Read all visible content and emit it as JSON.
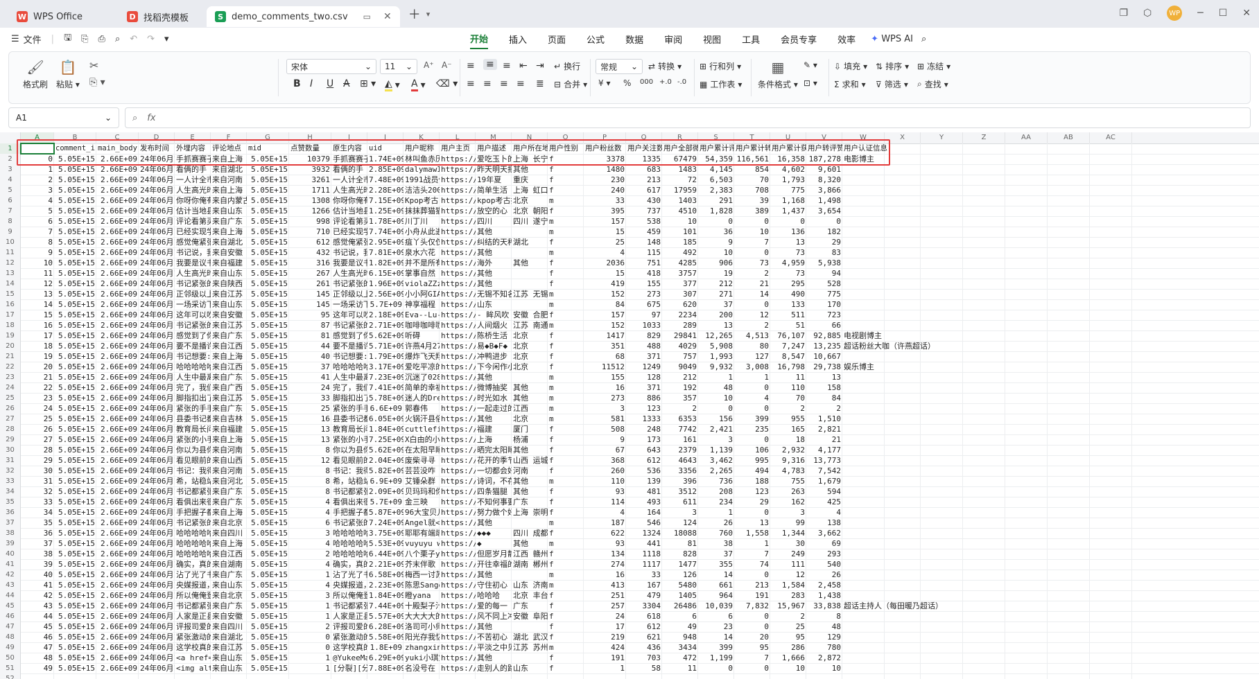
{
  "tabs": [
    {
      "label": "WPS Office",
      "icon": "wps-logo-icon",
      "color": "#e94b3c"
    },
    {
      "label": "找稻壳模板",
      "icon": "docer-icon",
      "color": "#e94b3c"
    },
    {
      "label": "demo_comments_two.csv",
      "icon": "sheet-icon",
      "color": "#1a9e55"
    }
  ],
  "menu": {
    "file": "文件",
    "tabs": [
      "开始",
      "插入",
      "页面",
      "公式",
      "数据",
      "审阅",
      "视图",
      "工具",
      "会员专享",
      "效率"
    ],
    "active": "开始",
    "ai": "WPS AI"
  },
  "ribbon": {
    "format_painter": "格式刷",
    "paste": "粘贴",
    "font": "宋体",
    "size": "11",
    "wrap": "换行",
    "merge": "合并",
    "number_format": "常规",
    "convert": "转换",
    "rowcol": "行和列",
    "worksheet": "工作表",
    "cond_format": "条件格式",
    "fill": "填充",
    "sort": "排序",
    "freeze": "冻结",
    "sum": "求和",
    "filter": "筛选",
    "find": "查找"
  },
  "formula_bar": {
    "cell_ref": "A1",
    "formula": ""
  },
  "columns": [
    "A",
    "B",
    "C",
    "D",
    "E",
    "F",
    "G",
    "H",
    "I",
    "J",
    "K",
    "L",
    "M",
    "N",
    "O",
    "P",
    "Q",
    "R",
    "S",
    "T",
    "U",
    "V",
    "W",
    "X",
    "Y",
    "Z",
    "AA",
    "AB",
    "AC"
  ],
  "header_row": [
    "",
    "comment_i",
    "main_body",
    "发布时间",
    "外埋内容",
    "评论地点",
    "mid",
    "点赞数量",
    "原生内容",
    "uid",
    "用户昵称",
    "用户主页",
    "用户描述",
    "用户所在地",
    "用户性别",
    "用户粉丝数",
    "用户关注数",
    "用户全部微",
    "用户累计评",
    "用户累计转",
    "用户累计获",
    "用户转评赞",
    "用户认证信息"
  ],
  "rows": [
    [
      "0",
      "5.05E+15",
      "2.66E+09",
      "24年06月1",
      "手抓赛赛子",
      "来自上海",
      "5.05E+15",
      "10379",
      "手抓赛赛子",
      "1.74E+09",
      "林叫鱼赤历",
      "https://we",
      "爱吃玉卜的",
      "上海 长宁",
      "f",
      "3378",
      "1335",
      "67479",
      "54,359",
      "116,561",
      "16,358",
      "187,278",
      "电影博主"
    ],
    [
      "1",
      "5.05E+15",
      "2.66E+09",
      "24年06月1",
      "看俩的手",
      "来自湖北",
      "5.05E+15",
      "3932",
      "看俩的手 ",
      "2.85E+09",
      "dalymawI",
      "https://we",
      "昨天明天把",
      "其他",
      "f",
      "1480",
      "683",
      "1483",
      "4,145",
      "854",
      "4,602",
      "9,601",
      ""
    ],
    [
      "2",
      "5.05E+15",
      "2.66E+09",
      "24年06月1",
      "一人计全市",
      "来自河南",
      "5.05E+15",
      "3261",
      "一人计全市",
      "7.48E+09",
      "1991战员你",
      "https://we",
      "19年夏 ",
      "重庆",
      "f",
      "230",
      "213",
      "72",
      "6,503",
      "70",
      "1,793",
      "8,320",
      ""
    ],
    [
      "3",
      "5.05E+15",
      "2.66E+09",
      "24年06月1",
      "人生高光时",
      "来自上海",
      "5.05E+15",
      "1711",
      "人生高光时",
      "2.28E+09",
      "洁洁头2005",
      "https://we",
      "简单生活 ",
      "上海 虹口",
      "f",
      "240",
      "617",
      "17959",
      "2,383",
      "708",
      "775",
      "3,866",
      ""
    ],
    [
      "4",
      "5.05E+15",
      "2.66E+09",
      "24年06月1",
      "你呀你俺有",
      "来自内蒙古",
      "5.05E+15",
      "1308",
      "你呀你俺有",
      "7.15E+09",
      "Kpop考古",
      "https://we",
      "kpop考古抄",
      "北京",
      "m",
      "33",
      "430",
      "1403",
      "291",
      "39",
      "1,168",
      "1,498",
      ""
    ],
    [
      "5",
      "5.05E+15",
      "2.66E+09",
      "24年06月1",
      "估计当地县",
      "来自山东",
      "5.05E+15",
      "1266",
      "估计当地县",
      "1.25E+09",
      "抹抹葬猫猫",
      "https://we",
      "放空的心",
      "北京 朝阳",
      "f",
      "395",
      "737",
      "4510",
      "1,828",
      "389",
      "1,437",
      "3,654",
      ""
    ],
    [
      "6",
      "5.05E+15",
      "2.66E+09",
      "24年06月1",
      "评论看第买",
      "来自广东",
      "5.05E+15",
      "998",
      "评论看第买",
      "1.78E+09",
      "川丁川",
      "https://we",
      "四川 ",
      "四川 遂宁",
      "m",
      "157",
      "538",
      "10",
      "0",
      "0",
      "0",
      "0",
      ""
    ],
    [
      "7",
      "5.05E+15",
      "2.66E+09",
      "24年06月1",
      "已经实现学",
      "来自上海",
      "5.05E+15",
      "710",
      "已经实现学",
      "7.74E+09",
      "小舟从此逝",
      "https://we",
      "其他",
      "",
      "m",
      "15",
      "459",
      "101",
      "36",
      "10",
      "136",
      "182",
      ""
    ],
    [
      "8",
      "5.05E+15",
      "2.66E+09",
      "24年06月1",
      "感觉俺紧张",
      "来自湖北",
      "5.05E+15",
      "612",
      "感觉俺紧张",
      "2.95E+09",
      "疽丫头仅仅",
      "https://we",
      "纠结的天秤",
      "湖北",
      "f",
      "25",
      "148",
      "185",
      "9",
      "7",
      "13",
      "29",
      ""
    ],
    [
      "9",
      "5.05E+15",
      "2.66E+09",
      "24年06月1",
      "书记说，我",
      "来自安徽",
      "5.05E+15",
      "432",
      "书记说，我",
      "7.81E+09",
      "泉水六花",
      "https://we",
      "其他",
      "",
      "m",
      "4",
      "115",
      "492",
      "10",
      "0",
      "73",
      "83",
      ""
    ],
    [
      "10",
      "5.05E+15",
      "2.66E+09",
      "24年06月1",
      "我要是议书",
      "来自福建",
      "5.05E+15",
      "316",
      "我要是议书",
      "1.82E+09",
      "并不是所有",
      "https://we",
      "海外 ",
      "其他",
      "f",
      "2036",
      "751",
      "4285",
      "906",
      "73",
      "4,959",
      "5,938",
      ""
    ],
    [
      "11",
      "5.05E+15",
      "2.66E+09",
      "24年06月1",
      "人生高光时",
      "来自山东",
      "5.05E+15",
      "267",
      "人生高光时",
      "6.15E+09",
      "掌事自然",
      "https://we",
      "其他",
      "",
      "f",
      "15",
      "418",
      "3757",
      "19",
      "2",
      "73",
      "94",
      ""
    ],
    [
      "12",
      "5.05E+15",
      "2.66E+09",
      "24年06月1",
      "书记紧张的",
      "来自陕西",
      "5.05E+15",
      "261",
      "书记紧张的",
      "1.96E+09",
      "violaZZzzz",
      "https://we",
      "其他",
      "",
      "f",
      "419",
      "155",
      "377",
      "212",
      "21",
      "295",
      "528",
      ""
    ],
    [
      "13",
      "5.05E+15",
      "2.66E+09",
      "24年06月1",
      "正邻级以上",
      "来自江苏",
      "5.05E+15",
      "145",
      "正邻级以上",
      "2.56E+09",
      "小小阿GIAC",
      "https://we",
      "无锡不知名",
      "江苏 无锡",
      "m",
      "152",
      "273",
      "307",
      "271",
      "14",
      "490",
      "775",
      ""
    ],
    [
      "14",
      "5.05E+15",
      "2.66E+09",
      "24年06月1",
      "一场采访下",
      "来自山东",
      "5.05E+15",
      "145",
      "一场采访下",
      "5.7E+09",
      "神享福程",
      "https://we",
      "山东",
      "",
      "m",
      "84",
      "675",
      "620",
      "37",
      "0",
      "133",
      "170",
      ""
    ],
    [
      "15",
      "5.05E+15",
      "2.66E+09",
      "24年06月1",
      "这年可以吹",
      "来自安徽",
      "5.05E+15",
      "95",
      "这年可以吹",
      "2.18E+09",
      "Eva--Lu-",
      "https://we",
      "- 眸风吹",
      "安徽 合肥",
      "f",
      "157",
      "97",
      "2234",
      "200",
      "12",
      "511",
      "723",
      ""
    ],
    [
      "16",
      "5.05E+15",
      "2.66E+09",
      "24年06月1",
      "书记紧张的",
      "来自江苏",
      "5.05E+15",
      "87",
      "书记紧张的",
      "2.71E+09",
      "咖啡咖啡咖",
      "https://we",
      "人间烟火",
      "江苏 南通",
      "m",
      "152",
      "1033",
      "289",
      "13",
      "2",
      "51",
      "66",
      ""
    ],
    [
      "17",
      "5.05E+15",
      "2.66E+09",
      "24年06月1",
      "感觉到了你",
      "来自广东",
      "5.05E+15",
      "81",
      "感觉到了你",
      "5.62E+09",
      "听碍",
      "https://we",
      "陈桥生活",
      "北京",
      "f",
      "1417",
      "829",
      "29841",
      "12,265",
      "4,513",
      "76,107",
      "92,885",
      "电视剧博主"
    ],
    [
      "18",
      "5.05E+15",
      "2.66E+09",
      "24年06月1",
      "要不是播许",
      "来自江西",
      "5.05E+15",
      "44",
      "要不是播许",
      "5.71E+09",
      "许燕4月27",
      "https://we",
      "易◆B◆F◆",
      "北京",
      "f",
      "351",
      "488",
      "4029",
      "5,908",
      "80",
      "7,247",
      "13,235",
      "超话粉丝大咖（许燕超话）"
    ],
    [
      "19",
      "5.05E+15",
      "2.66E+09",
      "24年06月1",
      "书记想要:",
      "来自上海",
      "5.05E+15",
      "40",
      "书记想要:",
      "1.79E+09",
      "爆炸飞天翔",
      "https://we",
      "冲鸭进步",
      "北京",
      "f",
      "68",
      "371",
      "757",
      "1,993",
      "127",
      "8,547",
      "10,667",
      ""
    ],
    [
      "20",
      "5.05E+15",
      "2.66E+09",
      "24年06月1",
      "哈哈哈哈哈",
      "来自江西",
      "5.05E+15",
      "37",
      "哈哈哈哈哈",
      "3.17E+09",
      "爱吃平凉的",
      "https://we",
      "下今闲作小",
      "北京",
      "f",
      "11512",
      "1249",
      "9049",
      "9,932",
      "3,008",
      "16,798",
      "29,738",
      "娱乐博主"
    ],
    [
      "21",
      "5.05E+15",
      "2.66E+09",
      "24年06月1",
      "人生中最离",
      "来自广东",
      "5.05E+15",
      "41",
      "人生中最离",
      "7.23E+09",
      "沉迷了0282",
      "https://we",
      "其他",
      "",
      "m",
      "155",
      "128",
      "212",
      "1",
      "1",
      "11",
      "13",
      ""
    ],
    [
      "22",
      "5.05E+15",
      "2.66E+09",
      "24年06月1",
      "完了，我们",
      "来自广西",
      "5.05E+15",
      "24",
      "完了，我们",
      "7.41E+09",
      "简单的幸福",
      "https://we",
      "微博抽奖",
      "其他",
      "m",
      "16",
      "371",
      "192",
      "48",
      "0",
      "110",
      "158",
      ""
    ],
    [
      "23",
      "5.05E+15",
      "2.66E+09",
      "24年06月1",
      "脚指扣出了",
      "来自江苏",
      "5.05E+15",
      "33",
      "脚指扣出了",
      "5.78E+09",
      "迷人的Dres",
      "https://we",
      "时光如水",
      "其他",
      "m",
      "273",
      "886",
      "357",
      "10",
      "4",
      "70",
      "84",
      ""
    ],
    [
      "24",
      "5.05E+15",
      "2.66E+09",
      "24年06月1",
      "紧张的手手",
      "来自广东",
      "5.05E+15",
      "25",
      "紧张的手手",
      "6.6E+09",
      "郭春伟",
      "https://we",
      "一起走过的",
      "江西",
      "m",
      "3",
      "123",
      "2",
      "0",
      "0",
      "2",
      "2",
      ""
    ],
    [
      "25",
      "5.05E+15",
      "2.66E+09",
      "24年06月1",
      "县委书记都",
      "来自吉林",
      "5.05E+15",
      "16",
      "县委书记都",
      "6.05E+09",
      "火锅汗县俗",
      "https://we",
      "其他",
      "北京",
      "m",
      "581",
      "1333",
      "6353",
      "156",
      "399",
      "955",
      "1,510",
      ""
    ],
    [
      "26",
      "5.05E+15",
      "2.66E+09",
      "24年06月1",
      "教育局长问",
      "来自福建",
      "5.05E+15",
      "13",
      "教育局长问",
      "1.84E+09",
      "cuttlefish",
      "https://we",
      "福建 ",
      "厦门",
      "f",
      "508",
      "248",
      "7742",
      "2,421",
      "235",
      "165",
      "2,821",
      ""
    ],
    [
      "27",
      "5.05E+15",
      "2.66E+09",
      "24年06月1",
      "紧张的小手",
      "来自上海",
      "5.05E+15",
      "13",
      "紧张的小手",
      "7.25E+09",
      "X白由的小",
      "https://we",
      "上海 ",
      "杨浦",
      "f",
      "9",
      "173",
      "161",
      "3",
      "0",
      "18",
      "21",
      ""
    ],
    [
      "28",
      "5.05E+15",
      "2.66E+09",
      "24年06月1",
      "你以为县你",
      "来自河南",
      "5.05E+15",
      "8",
      "你以为县你",
      "5.62E+09",
      "在太阳早睡",
      "https://we",
      "晒完太阳睡",
      "其他",
      "f",
      "67",
      "643",
      "2379",
      "1,139",
      "106",
      "2,932",
      "4,177",
      ""
    ],
    [
      "29",
      "5.05E+15",
      "2.66E+09",
      "24年06月1",
      "看见眼前的",
      "来自山西",
      "5.05E+15",
      "12",
      "看见眼前的",
      "2.04E+09",
      "废柴寻寻",
      "https://we",
      "花开的季节",
      "山西 运城",
      "f",
      "368",
      "612",
      "4643",
      "3,462",
      "995",
      "9,316",
      "13,773",
      ""
    ],
    [
      "30",
      "5.05E+15",
      "2.66E+09",
      "24年06月1",
      "书记：我得",
      "来自河南",
      "5.05E+15",
      "8",
      "书记：我得",
      "5.82E+09",
      "芸芸没咋",
      "https://we",
      "一切都会好",
      "河南",
      "f",
      "260",
      "536",
      "3356",
      "2,265",
      "494",
      "4,783",
      "7,542",
      ""
    ],
    [
      "31",
      "5.05E+15",
      "2.66E+09",
      "24年06月1",
      "希，站稳站",
      "来自河北",
      "5.05E+15",
      "8",
      "希，站稳站",
      "6.9E+09",
      "艾锤朵群",
      "https://we",
      "诗词，不存",
      "其他",
      "m",
      "110",
      "139",
      "396",
      "736",
      "188",
      "755",
      "1,679",
      ""
    ],
    [
      "32",
      "5.05E+15",
      "2.66E+09",
      "24年06月1",
      "书记都紧张",
      "来自广东",
      "5.05E+15",
      "8",
      "书记都紧张",
      "2.09E+09",
      "贝玛玛和你",
      "https://we",
      "四条猫腿",
      "其他 ",
      "f",
      "93",
      "481",
      "3512",
      "208",
      "123",
      "263",
      "594",
      ""
    ],
    [
      "33",
      "5.05E+15",
      "2.66E+09",
      "24年06月1",
      "看俱出来很",
      "来自广东",
      "5.05E+15",
      "4",
      "看俱出来很",
      "5.7E+09",
      "金三映",
      "https://we",
      "不知何事要",
      "广东",
      "f",
      "114",
      "493",
      "611",
      "234",
      "29",
      "162",
      "425",
      ""
    ],
    [
      "34",
      "5.05E+15",
      "2.66E+09",
      "24年06月1",
      "手把握子都",
      "来自上海",
      "5.05E+15",
      "4",
      "手把握子都",
      "5.87E+09",
      "96大宝贝儿",
      "https://we",
      "努力做个好",
      "上海 崇明",
      "f",
      "4",
      "164",
      "3",
      "1",
      "0",
      "3",
      "4",
      ""
    ],
    [
      "35",
      "5.05E+15",
      "2.66E+09",
      "24年06月1",
      "书记紧张的",
      "来自北京",
      "5.05E+15",
      "6",
      "书记紧张的",
      "7.24E+09",
      "Angel就</thinking>",
      "https://we",
      "其他",
      "",
      "m",
      "187",
      "546",
      "124",
      "26",
      "13",
      "99",
      "138",
      ""
    ],
    [
      "36",
      "5.05E+15",
      "2.66E+09",
      "24年06月1",
      "哈哈哈哈哈",
      "来自四川",
      "5.05E+15",
      "3",
      "哈哈哈哈哈",
      "3.75E+09",
      "耶耶有端端",
      "https://we",
      "◆◆◆",
      "四川 成都",
      "f",
      "622",
      "1324",
      "18088",
      "760",
      "1,558",
      "1,344",
      "3,662",
      ""
    ],
    [
      "37",
      "5.05E+15",
      "2.66E+09",
      "24年06月1",
      "哈哈哈哈哈",
      "来自上海",
      "5.05E+15",
      "4",
      "哈哈哈哈哈",
      "5.53E+09",
      "vuyuyu wos",
      "https://we",
      "◆",
      "其他",
      "m",
      "93",
      "441",
      "81",
      "38",
      "1",
      "30",
      "69",
      ""
    ],
    [
      "38",
      "5.05E+15",
      "2.66E+09",
      "24年06月1",
      "哈哈哈哈哈",
      "来自江西",
      "5.05E+15",
      "2",
      "哈哈哈哈哈",
      "6.44E+09",
      "八个栗子y",
      "https://we",
      "但愿岁月静",
      "江西 赣州",
      "f",
      "134",
      "1118",
      "828",
      "37",
      "7",
      "249",
      "293",
      ""
    ],
    [
      "39",
      "5.05E+15",
      "2.66E+09",
      "24年06月1",
      "确实，真的",
      "来自湖南",
      "5.05E+15",
      "4",
      "确实，真的",
      "2.21E+09",
      "芥末伴歌",
      "https://we",
      "开往幸福的",
      "湖南 郴州",
      "f",
      "274",
      "1117",
      "1477",
      "355",
      "74",
      "111",
      "540",
      ""
    ],
    [
      "40",
      "5.05E+15",
      "2.66E+09",
      "24年06月1",
      "沾了光了书",
      "来自广东",
      "5.05E+15",
      "1",
      "沾了光了书",
      "6.58E+09",
      "梅西一讨苏",
      "https://we",
      "其他",
      "",
      "m",
      "16",
      "33",
      "126",
      "14",
      "0",
      "12",
      "26",
      ""
    ],
    [
      "41",
      "5.05E+15",
      "2.66E+09",
      "24年06月1",
      "央媒报道，",
      "来自山东",
      "5.05E+15",
      "4",
      "央媒报道，",
      "2.23E+09",
      "陈思Sanger",
      "https://we",
      "守住初心",
      "山东 济南",
      "m",
      "413",
      "167",
      "5480",
      "661",
      "213",
      "1,584",
      "2,458",
      ""
    ],
    [
      "42",
      "5.05E+15",
      "2.66E+09",
      "24年06月1",
      "所以俺俺登",
      "来自北京",
      "5.05E+15",
      "3",
      "所以俺俺登",
      "1.84E+09",
      "瞪yana",
      "https://we",
      "哈哈哈",
      "北京 丰台",
      "f",
      "251",
      "479",
      "1405",
      "964",
      "191",
      "283",
      "1,438",
      ""
    ],
    [
      "43",
      "5.05E+15",
      "2.66E+09",
      "24年06月1",
      "书记都紧张",
      "来自广东",
      "5.05E+15",
      "1",
      "书记都紧张",
      "7.44E+09",
      "十殿梨子汁",
      "https://we",
      "爱的每一",
      "广东",
      "f",
      "257",
      "3304",
      "26486",
      "10,039",
      "7,832",
      "15,967",
      "33,838",
      "超话主持人（每田暖乃超话）"
    ],
    [
      "44",
      "5.05E+15",
      "2.66E+09",
      "24年06月1",
      "人家是正县",
      "来自安徽",
      "5.05E+15",
      "1",
      "人家是正县",
      "5.57E+09",
      "大大大大的",
      "https://we",
      "风不同上冲",
      "安徽 阜阳",
      "f",
      "24",
      "618",
      "6",
      "6",
      "0",
      "2",
      "8",
      ""
    ],
    [
      "45",
      "5.05E+15",
      "2.66E+09",
      "24年06月1",
      "评报司爱的",
      "来自四川",
      "5.05E+15",
      "2",
      "评报司爱的",
      "6.28E+09",
      "洛司可小师",
      "https://we",
      "其他",
      "",
      "f",
      "17",
      "612",
      "49",
      "23",
      "0",
      "25",
      "48",
      ""
    ],
    [
      "46",
      "5.05E+15",
      "2.66E+09",
      "24年06月1",
      "紧张激动的",
      "来自湖北",
      "5.05E+15",
      "0",
      "紧张激动的",
      "5.58E+09",
      "阳光存我忆",
      "https://we",
      "不苦初心",
      "湖北 武汉",
      "f",
      "219",
      "621",
      "948",
      "14",
      "20",
      "95",
      "129",
      ""
    ],
    [
      "47",
      "5.05E+15",
      "2.66E+09",
      "24年06月1",
      "这学校真的",
      "来自江苏",
      "5.05E+15",
      "0",
      "这学校真的",
      "1.8E+09",
      "zhangxing",
      "https://we",
      "平淡之中见",
      "江苏 苏州",
      "m",
      "424",
      "436",
      "3434",
      "399",
      "95",
      "286",
      "780",
      ""
    ],
    [
      "48",
      "5.05E+15",
      "2.66E+09",
      "24年06月1",
      "<a href=/n",
      "来自山东",
      "5.05E+15",
      "1",
      "@YukeeMari",
      "6.29E+09",
      "yuki小琪宝",
      "https://we",
      "其他",
      "",
      "f",
      "191",
      "703",
      "472",
      "1,199",
      "7",
      "1,666",
      "2,872",
      ""
    ],
    [
      "49",
      "5.05E+15",
      "2.66E+09",
      "24年06月1",
      "<img alt=\"",
      "来自山东",
      "5.05E+15",
      "1",
      "[分裂][分裂",
      "7.88E+09",
      "名没号在",
      "https://we",
      "走别人的路",
      "山东",
      "f",
      "1",
      "58",
      "11",
      "0",
      "0",
      "10",
      "10",
      ""
    ]
  ]
}
